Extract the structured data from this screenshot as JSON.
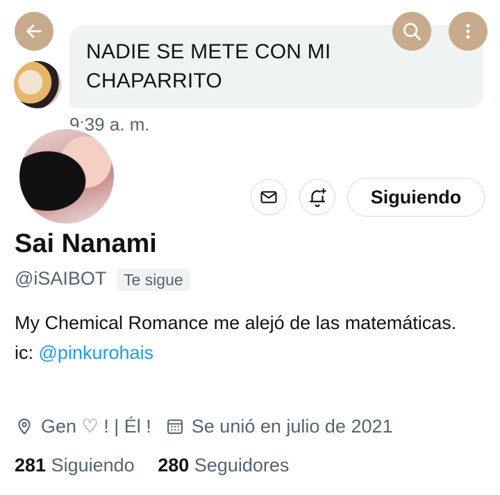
{
  "banner": {
    "bubble_line1": "NADIE SE METE CON MI",
    "bubble_line2": "CHAPARRITO",
    "timestamp": "9:39 a. m."
  },
  "topbar": {
    "back_icon": "arrow-left-icon",
    "search_icon": "search-icon",
    "more_icon": "more-vertical-icon",
    "button_color": "#c8ab8c"
  },
  "actions": {
    "message_icon": "envelope-icon",
    "notify_icon": "bell-plus-icon",
    "follow_label": "Siguiendo"
  },
  "profile": {
    "name": "Sai Nanami",
    "handle": "@iSAIBOT",
    "follows_you": "Te sigue",
    "bio_text": "My Chemical Romance me alejó de las matemáticas.   ic: ",
    "bio_link": "@pinkurohais",
    "location": "Gen ♡ ! | Él !",
    "joined": "Se unió en julio de 2021",
    "following_count": "281",
    "following_label": "Siguiendo",
    "followers_count": "280",
    "followers_label": "Seguidores"
  },
  "colors": {
    "link": "#1d9bf0",
    "secondary_text": "#536471",
    "bubble_bg": "#eff3f4"
  }
}
